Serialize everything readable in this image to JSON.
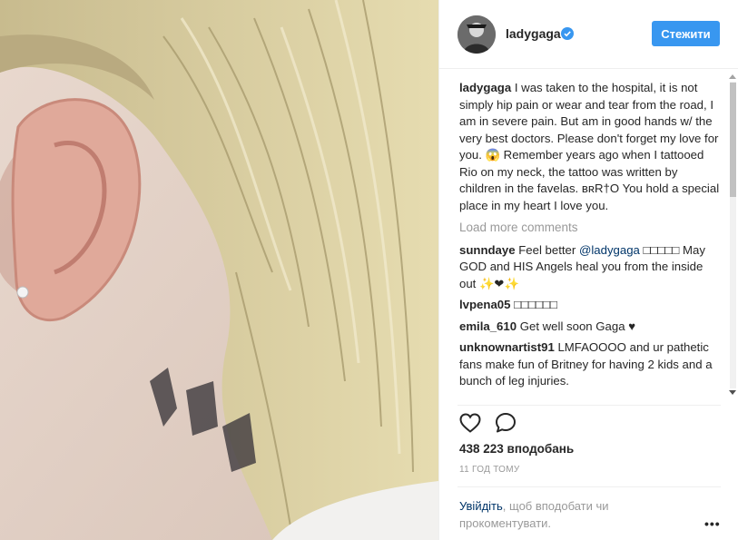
{
  "post": {
    "username": "ladygaga",
    "verified_icon": "verified-badge-icon",
    "follow_label": "Стежити",
    "caption": {
      "username": "ladygaga",
      "text": "I was taken to the hospital, it is not simply hip pain or wear and tear from the road, I am in severe pain. But am in good hands w/ the very best doctors. Please don't forget my love for you. 😱 Remember years ago when I tattooed Rio on my neck, the tattoo was written by children in the favelas. ʙʀR†O You hold a special place in my heart I love you."
    },
    "load_more": "Load more comments",
    "comments": [
      {
        "username": "sunndaye",
        "pre": "Feel better ",
        "mention": "@ladygaga",
        "post": " □□□□□ May GOD and HIS Angels heal you from the inside out ✨❤✨"
      },
      {
        "username": "lvpena05",
        "pre": "□□□□□□",
        "mention": "",
        "post": ""
      },
      {
        "username": "emila_610",
        "pre": "Get well soon Gaga ♥",
        "mention": "",
        "post": ""
      },
      {
        "username": "unknownartist91",
        "pre": "LMFAOOOO and ur pathetic fans make fun of Britney for having 2 kids and a bunch of leg injuries.",
        "mention": "",
        "post": ""
      }
    ],
    "likes": "438 223 вподобань",
    "time": "11 ГОД ТОМУ",
    "login_link": "Увійдіть",
    "login_text": ", щоб вподобати чи прокоментувати.",
    "more_icon": "more-options-icon",
    "more_glyph": "•••"
  },
  "icons": {
    "like": "heart-outline-icon",
    "comment": "comment-bubble-icon"
  },
  "colors": {
    "accent": "#3897f0",
    "link": "#003569",
    "muted": "#999999"
  }
}
